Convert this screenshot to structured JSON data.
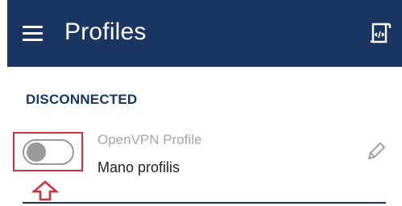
{
  "header": {
    "title": "Profiles",
    "menu_icon": "hamburger-menu-icon",
    "import_icon": "import-profile-icon"
  },
  "section": {
    "status_label": "DISCONNECTED"
  },
  "profile": {
    "type": "OpenVPN Profile",
    "name": "Mano profilis",
    "connected": false,
    "edit_icon": "pencil-icon"
  },
  "annotation": {
    "highlight_color": "#d0313c",
    "arrow_icon": "up-arrow-icon"
  },
  "colors": {
    "header_bg": "#1b3563",
    "toggle_off": "#9a9a9a",
    "accent": "#1b3563"
  }
}
